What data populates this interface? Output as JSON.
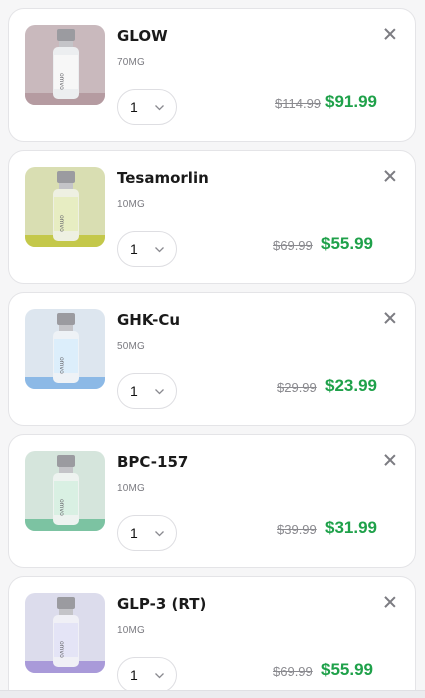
{
  "cart": {
    "items": [
      {
        "name": "GLOW",
        "dose": "70MG",
        "qty": "1",
        "old_price": "$114.99",
        "new_price": "$91.99",
        "bg": "#c9b9bd",
        "band": "#b59ba1"
      },
      {
        "name": "Tesamorlin",
        "dose": "10MG",
        "qty": "1",
        "old_price": "$69.99",
        "new_price": "$55.99",
        "bg": "#d9deb2",
        "band": "#c4c84a"
      },
      {
        "name": "GHK-Cu",
        "dose": "50MG",
        "qty": "1",
        "old_price": "$29.99",
        "new_price": "$23.99",
        "bg": "#dde6ef",
        "band": "#8cb9e6"
      },
      {
        "name": "BPC-157",
        "dose": "10MG",
        "qty": "1",
        "old_price": "$39.99",
        "new_price": "$31.99",
        "bg": "#d5e5dc",
        "band": "#7cc3a2"
      },
      {
        "name": "GLP-3 (RT)",
        "dose": "10MG",
        "qty": "1",
        "old_price": "$69.99",
        "new_price": "$55.99",
        "bg": "#dcdcec",
        "band": "#a99ad9"
      }
    ]
  },
  "icons": {
    "remove": "close-icon",
    "dropdown": "chevron-down-icon",
    "product": "vial-image"
  },
  "colors": {
    "price": "#1fa14a",
    "old_price": "#8a8a8f"
  }
}
